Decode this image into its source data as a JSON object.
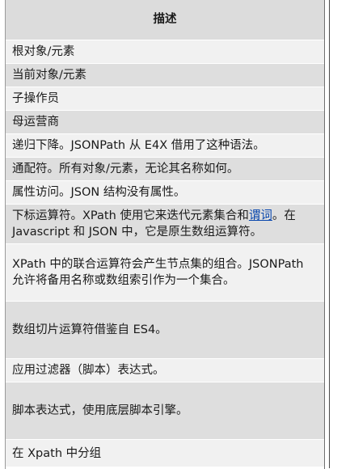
{
  "table": {
    "header": "描述",
    "rows": [
      {
        "text": "根对象/元素"
      },
      {
        "text": "当前对象/元素"
      },
      {
        "text": "子操作员"
      },
      {
        "text": "母运营商"
      },
      {
        "text": "递归下降。JSONPath 从 E4X 借用了这种语法。"
      },
      {
        "text": "通配符。所有对象/元素，无论其名称如何。"
      },
      {
        "text": "属性访问。JSON 结构没有属性。"
      },
      {
        "text_before": "下标运算符。XPath 使用它来迭代元素集合和",
        "link": "谓词",
        "text_after": "。在 Javascript 和 JSON 中，它是原生数组运算符。"
      },
      {
        "text": "XPath 中的联合运算符会产生节点集的组合。JSONPath 允许将备用名称或数组索引作为一个集合。"
      },
      {
        "text": "数组切片运算符借鉴自 ES4。"
      },
      {
        "text": "应用过滤器（脚本）表达式。"
      },
      {
        "text": "脚本表达式，使用底层脚本引擎。"
      },
      {
        "text": "在 Xpath 中分组"
      }
    ]
  },
  "colors": {
    "header_bg": "#dcdcdc",
    "row_odd": "#f1f1f1",
    "row_even": "#dedede",
    "link": "#0645ad"
  }
}
